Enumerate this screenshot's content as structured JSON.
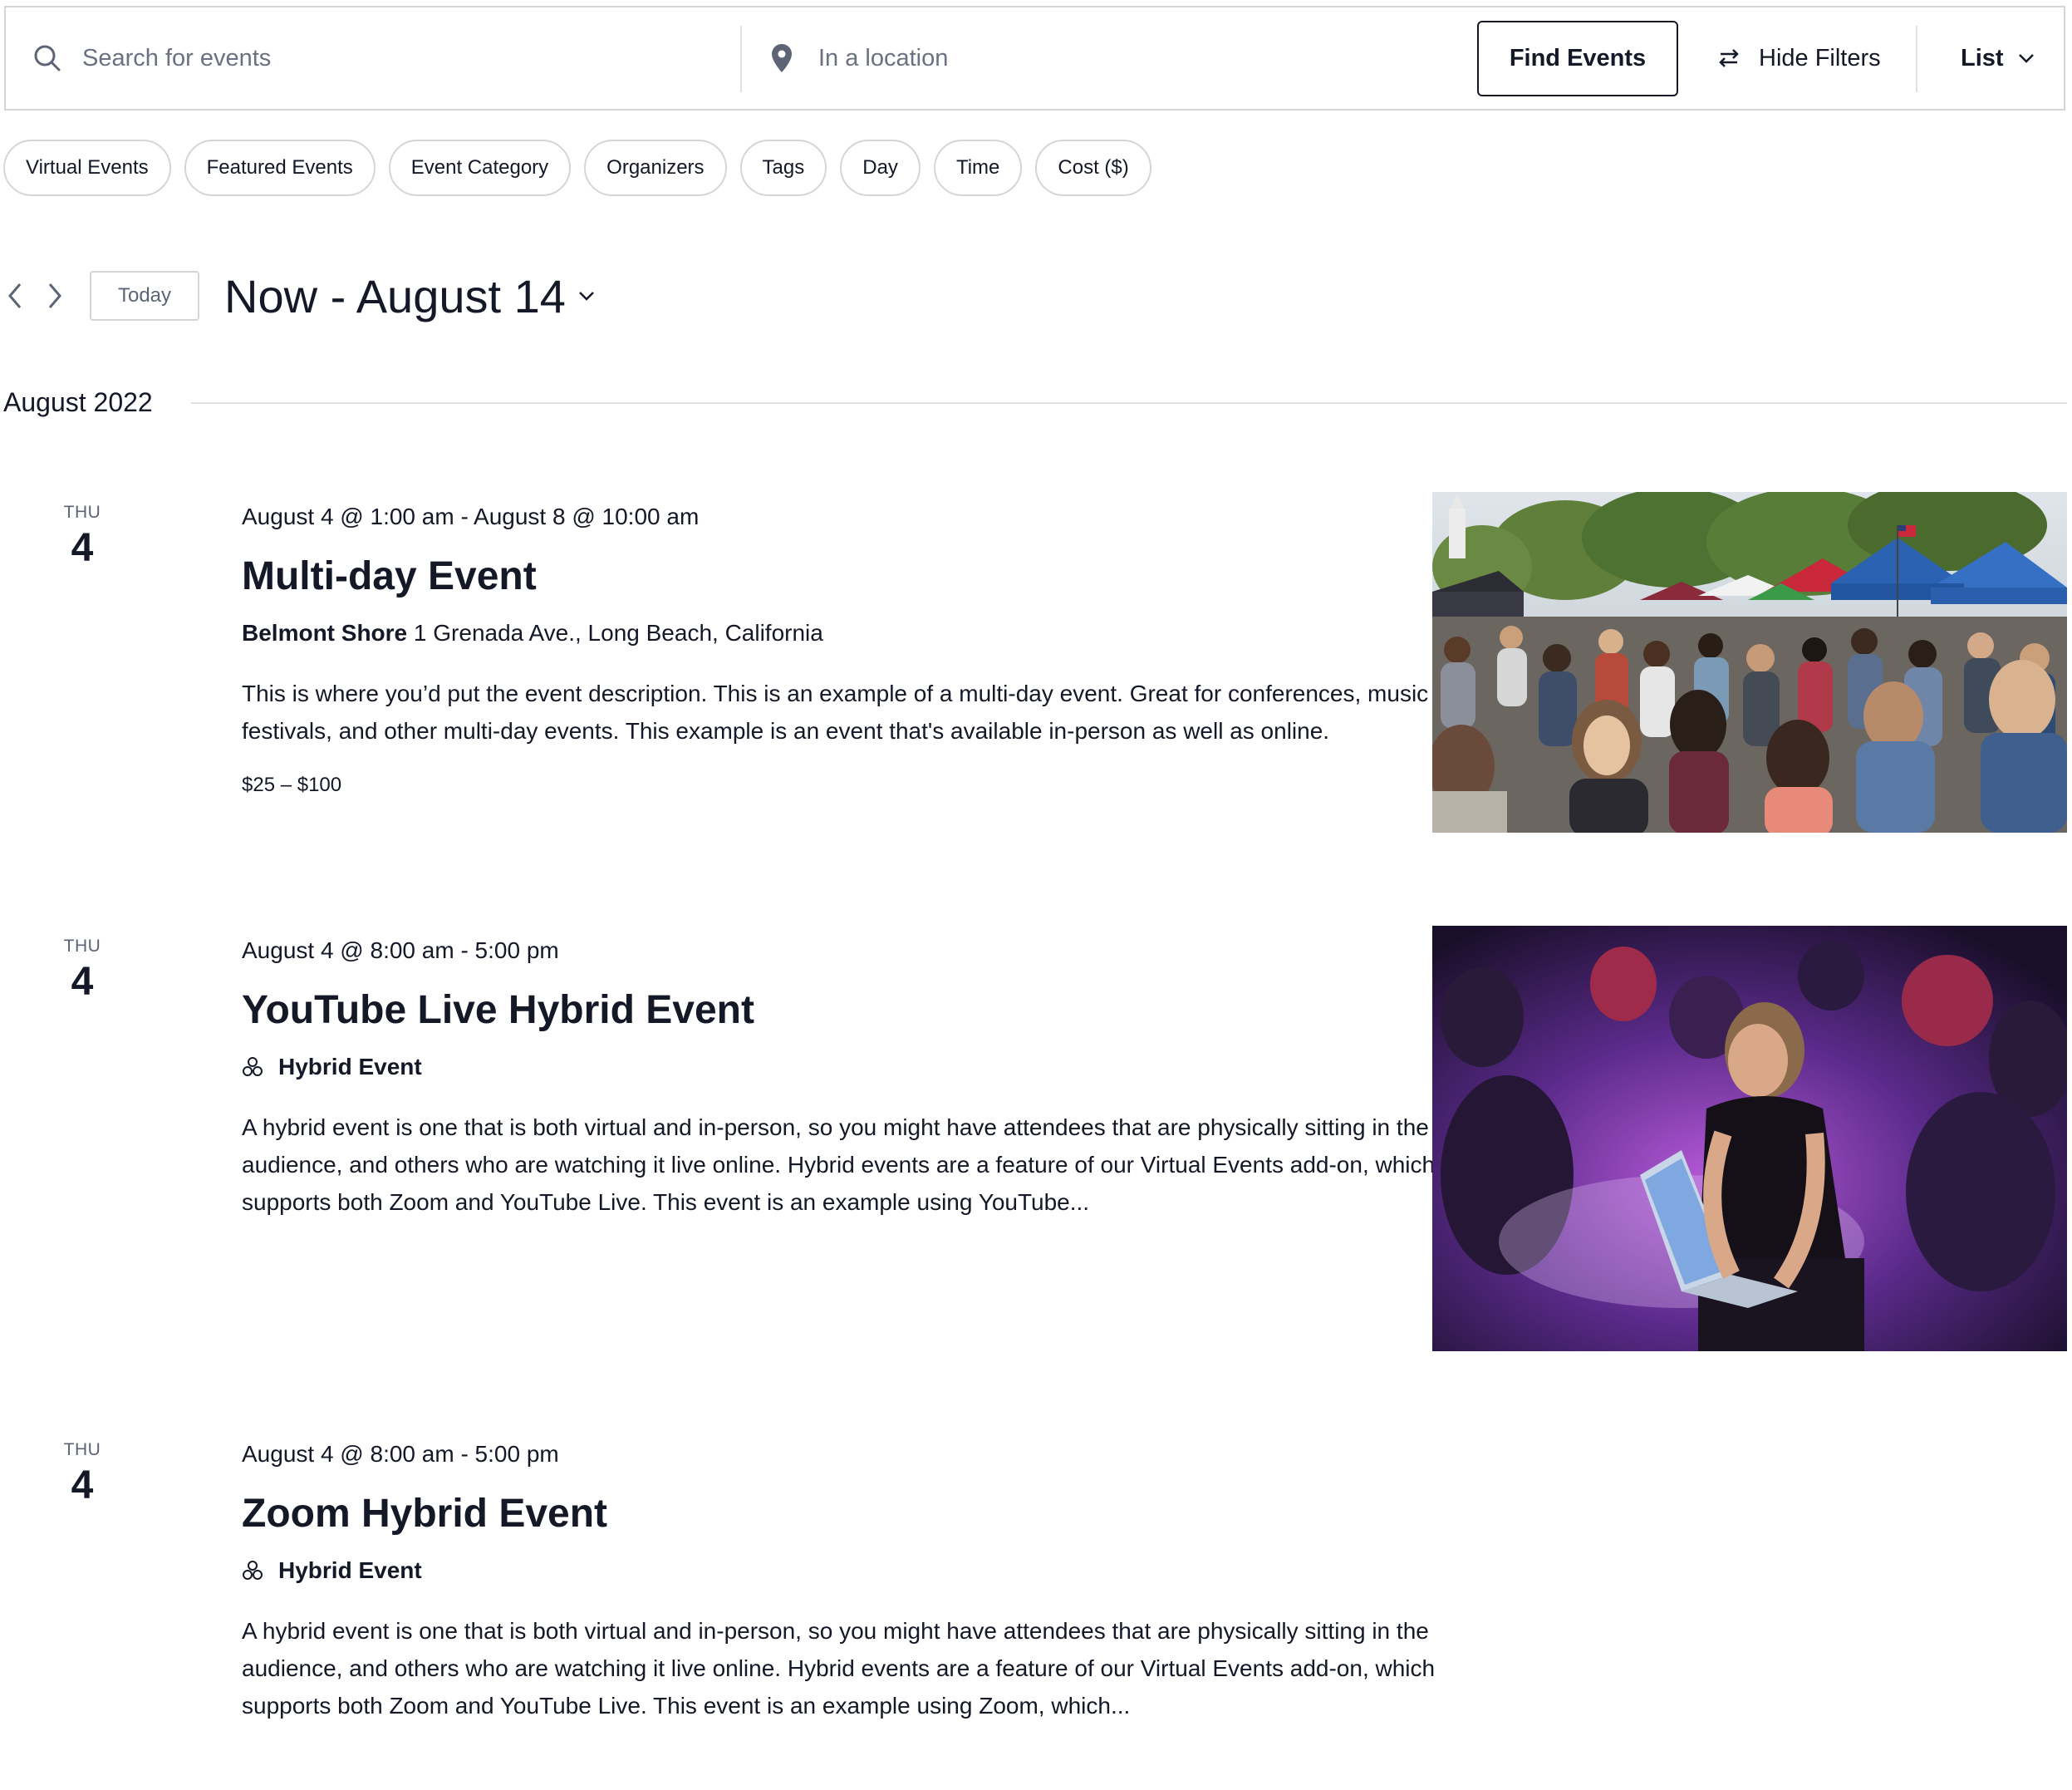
{
  "search": {
    "keyword_placeholder": "Search for events",
    "location_placeholder": "In a location",
    "find_button": "Find Events",
    "hide_filters": "Hide Filters",
    "view_label": "List"
  },
  "filters": [
    "Virtual Events",
    "Featured Events",
    "Event Category",
    "Organizers",
    "Tags",
    "Day",
    "Time",
    "Cost ($)"
  ],
  "nav": {
    "today": "Today",
    "range": "Now - August 14"
  },
  "month": "August 2022",
  "events": [
    {
      "dow": "THU",
      "day": "4",
      "time": "August 4 @ 1:00 am - August 8 @ 10:00 am",
      "title": "Multi-day Event",
      "venue_name": "Belmont Shore",
      "venue_address": "1 Grenada Ave., Long Beach, California",
      "description": "This is where you’d put the event description. This is an example of a multi-day event. Great for conferences, music festivals, and other multi-day events. This example is an event that's available in-person as well as online.",
      "cost": "$25 – $100",
      "image": "street-festival-crowd"
    },
    {
      "dow": "THU",
      "day": "4",
      "time": "August 4 @ 8:00 am - 5:00 pm",
      "title": "YouTube Live Hybrid Event",
      "tag": "Hybrid Event",
      "description": "A hybrid event is one that is both virtual and in-person, so you might have attendees that are physically sitting in the audience, and others who are watching it live online. Hybrid events are a feature of our Virtual Events add-on, which supports both Zoom and YouTube Live. This event is an example using YouTube...",
      "image": "man-with-laptop-at-event"
    },
    {
      "dow": "THU",
      "day": "4",
      "time": "August 4 @ 8:00 am - 5:00 pm",
      "title": "Zoom Hybrid Event",
      "tag": "Hybrid Event",
      "description": "A hybrid event is one that is both virtual and in-person, so you might have attendees that are physically sitting in the audience, and others who are watching it live online. Hybrid events are a feature of our Virtual Events add-on, which supports both Zoom and YouTube Live. This event is an example using Zoom, which..."
    }
  ],
  "icons": {
    "search": "search-icon",
    "location": "location-pin-icon",
    "filters": "filters-toggle-icon",
    "view": "chevron-down-icon",
    "prev": "chevron-left-icon",
    "next": "chevron-right-icon",
    "hybrid": "hybrid-event-icon"
  },
  "colors": {
    "text": "#141827",
    "muted": "#5d6476",
    "border": "#d5d5d5"
  }
}
